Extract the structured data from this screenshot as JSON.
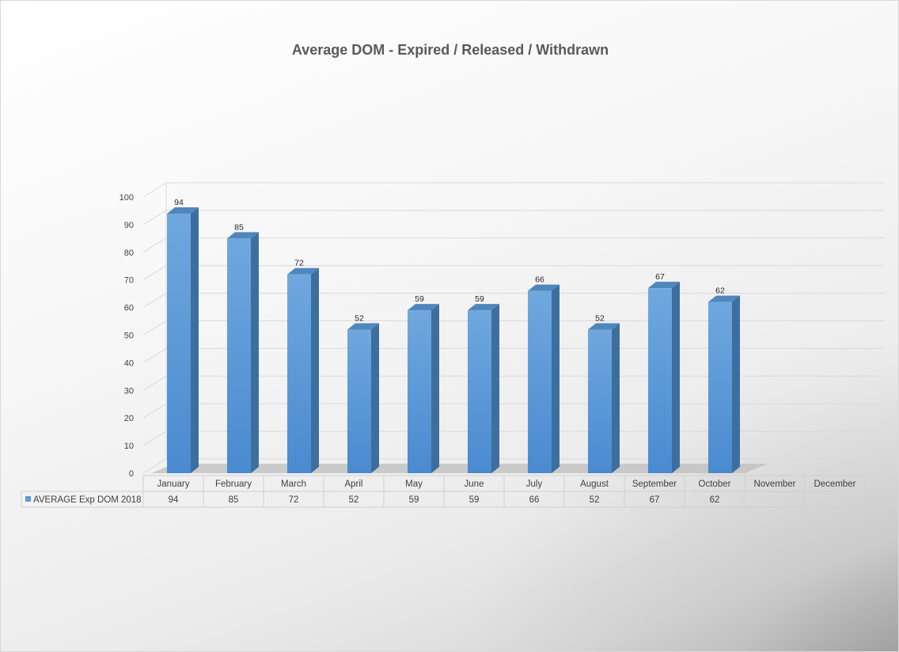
{
  "chart_data": {
    "type": "bar",
    "title": "Average DOM - Expired / Released / Withdrawn",
    "categories": [
      "January",
      "February",
      "March",
      "April",
      "May",
      "June",
      "July",
      "August",
      "September",
      "October",
      "November",
      "December"
    ],
    "series": [
      {
        "name": "AVERAGE Exp DOM 2018",
        "values": [
          94,
          85,
          72,
          52,
          59,
          59,
          66,
          52,
          67,
          62,
          null,
          null
        ],
        "color": "#5b9bd5"
      }
    ],
    "ylim": [
      0,
      100
    ],
    "yticks": [
      0,
      10,
      20,
      30,
      40,
      50,
      60,
      70,
      80,
      90,
      100
    ],
    "grid": true,
    "data_table": true,
    "style": "3d-column"
  }
}
